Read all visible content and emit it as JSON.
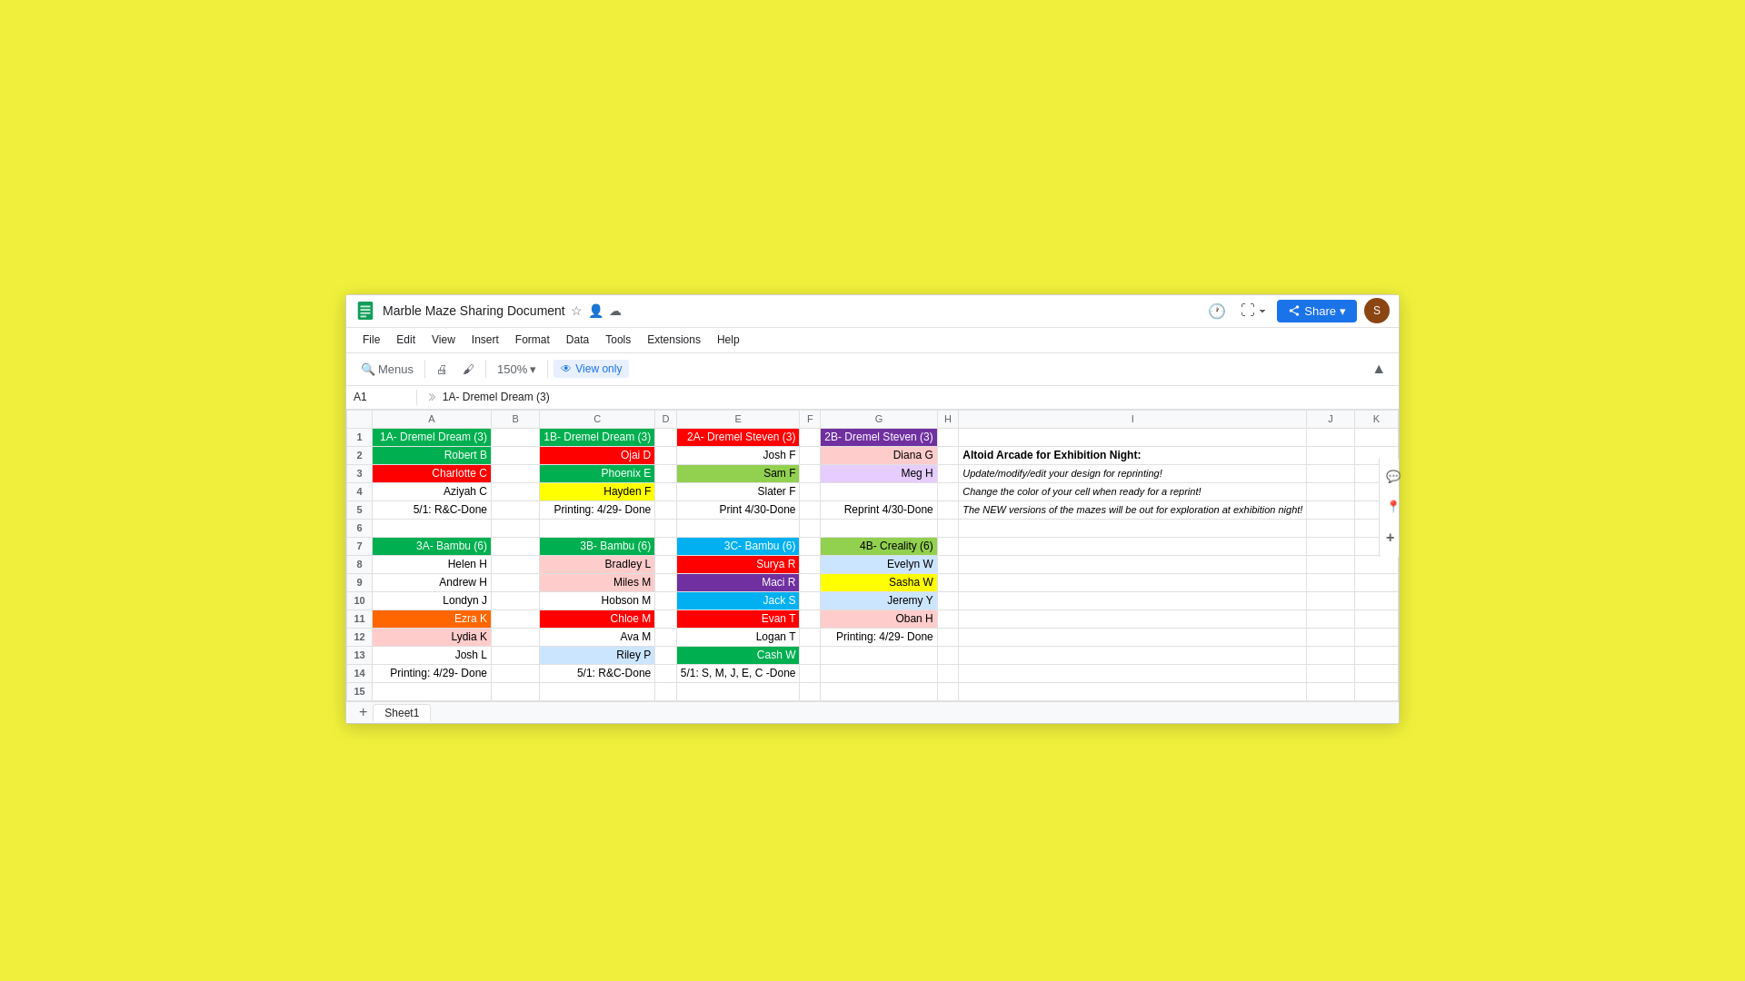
{
  "window": {
    "title": "Marble Maze Sharing Document",
    "doc_title": "Marble Maze Sharing Document"
  },
  "titlebar": {
    "menus": [
      "File",
      "Edit",
      "View",
      "Insert",
      "Format",
      "Data",
      "Tools",
      "Extensions",
      "Help"
    ],
    "share_label": "Share",
    "history_icon": "🕐",
    "zoom_icon": "⛶"
  },
  "toolbar": {
    "menus_label": "Menus",
    "print_icon": "🖨",
    "paint_icon": "🖌",
    "zoom_value": "150%",
    "view_only_label": "View only",
    "search_icon": "🔍"
  },
  "formula_bar": {
    "cell_ref": "A1",
    "content": "1A- Dremel Dream (3)"
  },
  "spreadsheet": {
    "col_headers": [
      "",
      "A",
      "B",
      "C",
      "D",
      "E",
      "F",
      "G",
      "H",
      "I",
      "J",
      "K"
    ],
    "rows": [
      {
        "num": "1",
        "cells": {
          "A": {
            "text": "1A- Dremel Dream (3)",
            "bg": "header-green",
            "color": "fff"
          },
          "B": {
            "text": ""
          },
          "C": {
            "text": "1B- Dremel Dream (3)",
            "bg": "bg-green",
            "color": "fff"
          },
          "D": {
            "text": ""
          },
          "E": {
            "text": "2A- Dremel Steven (3)",
            "bg": "bg-red",
            "color": "fff"
          },
          "F": {
            "text": ""
          },
          "G": {
            "text": "2B- Dremel Steven (3)",
            "bg": "bg-purple",
            "color": "fff"
          },
          "H": {
            "text": ""
          },
          "I": {
            "text": ""
          },
          "J": {
            "text": ""
          },
          "K": {
            "text": ""
          }
        }
      },
      {
        "num": "2",
        "cells": {
          "A": {
            "text": "Robert B",
            "bg": "bg-green",
            "color": "fff"
          },
          "B": {
            "text": ""
          },
          "C": {
            "text": "Ojai D",
            "bg": "bg-red",
            "color": "fff"
          },
          "D": {
            "text": ""
          },
          "E": {
            "text": "Josh F",
            "bg": "",
            "color": ""
          },
          "F": {
            "text": ""
          },
          "G": {
            "text": "Diana G",
            "bg": "bg-ltpink",
            "color": ""
          },
          "H": {
            "text": ""
          },
          "I": {
            "text": "Altoid Arcade for Exhibition Night:",
            "special": "bold"
          },
          "J": {
            "text": ""
          },
          "K": {
            "text": ""
          }
        }
      },
      {
        "num": "3",
        "cells": {
          "A": {
            "text": "Charlotte C",
            "bg": "bg-red",
            "color": "fff"
          },
          "B": {
            "text": ""
          },
          "C": {
            "text": "Phoenix E",
            "bg": "bg-green",
            "color": "fff"
          },
          "D": {
            "text": ""
          },
          "E": {
            "text": "Sam F",
            "bg": "bg-lime",
            "color": ""
          },
          "F": {
            "text": ""
          },
          "G": {
            "text": "Meg H",
            "bg": "bg-ltpurple",
            "color": ""
          },
          "H": {
            "text": ""
          },
          "I": {
            "text": "Update/modify/edit your design for reprinting!",
            "special": "italic"
          },
          "J": {
            "text": ""
          },
          "K": {
            "text": ""
          }
        }
      },
      {
        "num": "4",
        "cells": {
          "A": {
            "text": "Aziyah C",
            "bg": "",
            "color": ""
          },
          "B": {
            "text": ""
          },
          "C": {
            "text": "Hayden F",
            "bg": "bg-yellow",
            "color": ""
          },
          "D": {
            "text": ""
          },
          "E": {
            "text": "Slater F",
            "bg": "",
            "color": ""
          },
          "F": {
            "text": ""
          },
          "G": {
            "text": ""
          },
          "H": {
            "text": ""
          },
          "I": {
            "text": "Change the color of your cell when ready for a reprint!",
            "special": "italic"
          },
          "J": {
            "text": ""
          },
          "K": {
            "text": ""
          }
        }
      },
      {
        "num": "5",
        "cells": {
          "A": {
            "text": "5/1: R&C-Done",
            "bg": "",
            "color": ""
          },
          "B": {
            "text": ""
          },
          "C": {
            "text": "Printing: 4/29- Done",
            "bg": "",
            "color": ""
          },
          "D": {
            "text": ""
          },
          "E": {
            "text": "Print 4/30-Done",
            "bg": "",
            "color": ""
          },
          "F": {
            "text": ""
          },
          "G": {
            "text": "Reprint 4/30-Done",
            "bg": "",
            "color": ""
          },
          "H": {
            "text": ""
          },
          "I": {
            "text": "The NEW versions of the mazes will be out for exploration at exhibition night!",
            "special": "italic"
          },
          "J": {
            "text": ""
          },
          "K": {
            "text": ""
          }
        }
      },
      {
        "num": "6",
        "cells": {
          "A": {
            "text": ""
          },
          "B": {
            "text": ""
          },
          "C": {
            "text": ""
          },
          "D": {
            "text": ""
          },
          "E": {
            "text": ""
          },
          "F": {
            "text": ""
          },
          "G": {
            "text": ""
          },
          "H": {
            "text": ""
          },
          "I": {
            "text": ""
          },
          "J": {
            "text": ""
          },
          "K": {
            "text": ""
          }
        }
      },
      {
        "num": "7",
        "cells": {
          "A": {
            "text": "3A- Bambu (6)",
            "bg": "bg-green",
            "color": "fff"
          },
          "B": {
            "text": ""
          },
          "C": {
            "text": "3B- Bambu (6)",
            "bg": "bg-green",
            "color": "fff"
          },
          "D": {
            "text": ""
          },
          "E": {
            "text": "3C- Bambu (6)",
            "bg": "bg-cyan",
            "color": "fff"
          },
          "F": {
            "text": ""
          },
          "G": {
            "text": "4B- Creality (6)",
            "bg": "bg-lime",
            "color": ""
          },
          "H": {
            "text": ""
          },
          "I": {
            "text": ""
          },
          "J": {
            "text": ""
          },
          "K": {
            "text": ""
          }
        }
      },
      {
        "num": "8",
        "cells": {
          "A": {
            "text": "Helen H",
            "bg": "",
            "color": ""
          },
          "B": {
            "text": ""
          },
          "C": {
            "text": "Bradley L",
            "bg": "bg-ltpink",
            "color": ""
          },
          "D": {
            "text": ""
          },
          "E": {
            "text": "Surya R",
            "bg": "bg-red",
            "color": "fff"
          },
          "F": {
            "text": ""
          },
          "G": {
            "text": "Evelyn W",
            "bg": "bg-ltblue",
            "color": ""
          },
          "H": {
            "text": ""
          },
          "I": {
            "text": ""
          },
          "J": {
            "text": ""
          },
          "K": {
            "text": ""
          }
        }
      },
      {
        "num": "9",
        "cells": {
          "A": {
            "text": "Andrew H",
            "bg": "",
            "color": ""
          },
          "B": {
            "text": ""
          },
          "C": {
            "text": "Miles M",
            "bg": "bg-ltpink",
            "color": ""
          },
          "D": {
            "text": ""
          },
          "E": {
            "text": "Maci R",
            "bg": "bg-purple",
            "color": "fff"
          },
          "F": {
            "text": ""
          },
          "G": {
            "text": "Sasha W",
            "bg": "bg-yellow",
            "color": ""
          },
          "H": {
            "text": ""
          },
          "I": {
            "text": ""
          },
          "J": {
            "text": ""
          },
          "K": {
            "text": ""
          }
        }
      },
      {
        "num": "10",
        "cells": {
          "A": {
            "text": "Londyn J",
            "bg": "",
            "color": ""
          },
          "B": {
            "text": ""
          },
          "C": {
            "text": "Hobson M",
            "bg": "",
            "color": ""
          },
          "D": {
            "text": ""
          },
          "E": {
            "text": "Jack S",
            "bg": "bg-cyan",
            "color": "fff"
          },
          "F": {
            "text": ""
          },
          "G": {
            "text": "Jeremy Y",
            "bg": "bg-ltblue",
            "color": ""
          },
          "H": {
            "text": ""
          },
          "I": {
            "text": ""
          },
          "J": {
            "text": ""
          },
          "K": {
            "text": ""
          }
        }
      },
      {
        "num": "11",
        "cells": {
          "A": {
            "text": "Ezra K",
            "bg": "bg-orange",
            "color": "fff"
          },
          "B": {
            "text": ""
          },
          "C": {
            "text": "Chloe M",
            "bg": "bg-red",
            "color": "fff"
          },
          "D": {
            "text": ""
          },
          "E": {
            "text": "Evan T",
            "bg": "bg-red",
            "color": "fff"
          },
          "F": {
            "text": ""
          },
          "G": {
            "text": "Oban H",
            "bg": "bg-ltpink",
            "color": ""
          },
          "H": {
            "text": ""
          },
          "I": {
            "text": ""
          },
          "J": {
            "text": ""
          },
          "K": {
            "text": ""
          }
        }
      },
      {
        "num": "12",
        "cells": {
          "A": {
            "text": "Lydia K",
            "bg": "bg-ltpink",
            "color": ""
          },
          "B": {
            "text": ""
          },
          "C": {
            "text": "Ava M",
            "bg": "",
            "color": ""
          },
          "D": {
            "text": ""
          },
          "E": {
            "text": "Logan T",
            "bg": "",
            "color": ""
          },
          "F": {
            "text": ""
          },
          "G": {
            "text": "Printing: 4/29- Done",
            "bg": "",
            "color": ""
          },
          "H": {
            "text": ""
          },
          "I": {
            "text": ""
          },
          "J": {
            "text": ""
          },
          "K": {
            "text": ""
          }
        }
      },
      {
        "num": "13",
        "cells": {
          "A": {
            "text": "Josh L",
            "bg": "",
            "color": ""
          },
          "B": {
            "text": ""
          },
          "C": {
            "text": "Riley P",
            "bg": "bg-ltblue",
            "color": ""
          },
          "D": {
            "text": ""
          },
          "E": {
            "text": "Cash W",
            "bg": "bg-green",
            "color": "fff"
          },
          "F": {
            "text": ""
          },
          "G": {
            "text": ""
          },
          "H": {
            "text": ""
          },
          "I": {
            "text": ""
          },
          "J": {
            "text": ""
          },
          "K": {
            "text": ""
          }
        }
      },
      {
        "num": "14",
        "cells": {
          "A": {
            "text": "Printing: 4/29- Done",
            "bg": "",
            "color": ""
          },
          "B": {
            "text": ""
          },
          "C": {
            "text": "5/1: R&C-Done",
            "bg": "",
            "color": ""
          },
          "D": {
            "text": ""
          },
          "E": {
            "text": "5/1: S, M, J, E, C -Done",
            "bg": "",
            "color": ""
          },
          "F": {
            "text": ""
          },
          "G": {
            "text": ""
          },
          "H": {
            "text": ""
          },
          "I": {
            "text": ""
          },
          "J": {
            "text": ""
          },
          "K": {
            "text": ""
          }
        }
      },
      {
        "num": "15",
        "cells": {
          "A": {
            "text": ""
          },
          "B": {
            "text": ""
          },
          "C": {
            "text": ""
          },
          "D": {
            "text": ""
          },
          "E": {
            "text": ""
          },
          "F": {
            "text": ""
          },
          "G": {
            "text": ""
          },
          "H": {
            "text": ""
          },
          "I": {
            "text": ""
          },
          "J": {
            "text": ""
          },
          "K": {
            "text": ""
          }
        }
      }
    ]
  },
  "bottom_bar": {
    "sheet_name": "Sheet1",
    "add_label": "+"
  },
  "right_panel": {
    "icons": [
      "comments",
      "map",
      "plus"
    ]
  }
}
